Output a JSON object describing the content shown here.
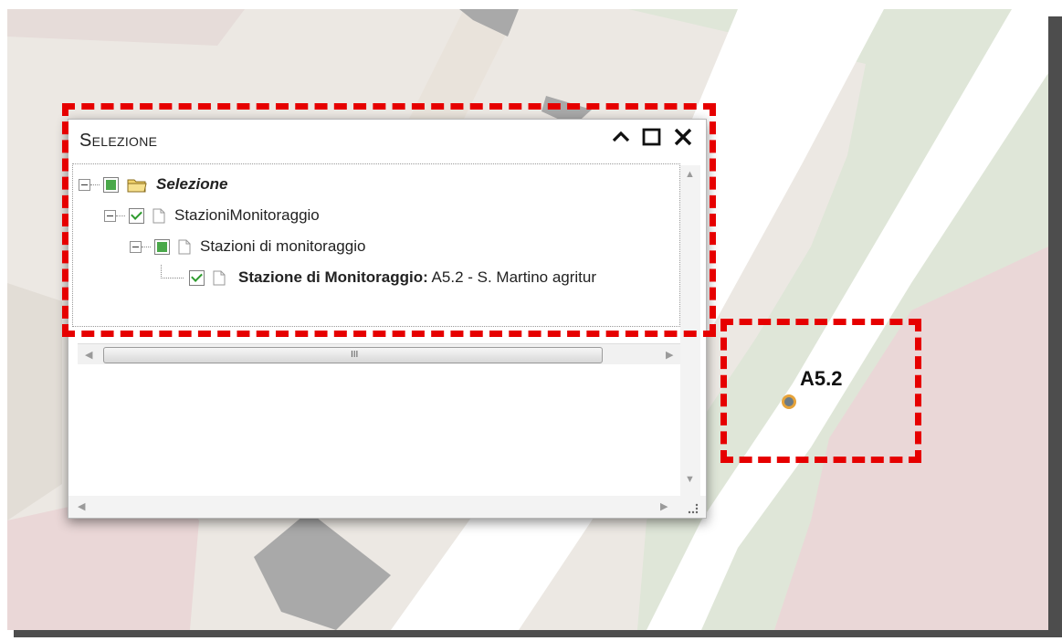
{
  "panel": {
    "title": "Selezione",
    "controls": {
      "collapse": "^",
      "maximize": "☐",
      "close": "✕"
    }
  },
  "tree": {
    "root": {
      "label": "Selezione",
      "state": "partial",
      "icon": "folder-icon"
    },
    "level1": {
      "label": "StazioniMonitoraggio",
      "state": "checked",
      "icon": "file-icon"
    },
    "level2": {
      "label": "Stazioni di monitoraggio",
      "state": "partial",
      "icon": "file-icon"
    },
    "level3": {
      "label_bold": "Stazione di Monitoraggio:",
      "label_rest": " A5.2 - S. Martino agritur",
      "state": "checked",
      "icon": "file-icon"
    }
  },
  "scroll": {
    "grip": "III"
  },
  "map": {
    "station_label": "A5.2",
    "colors": {
      "background": "#ece8e3",
      "green_zone": "#dfe6d8",
      "red_zone": "#ead7d7",
      "road": "#ffffff",
      "building": "#a9a9a9",
      "highlight": "#e60000",
      "station_fill": "#6d7b86",
      "station_ring": "#e6a33a"
    }
  }
}
